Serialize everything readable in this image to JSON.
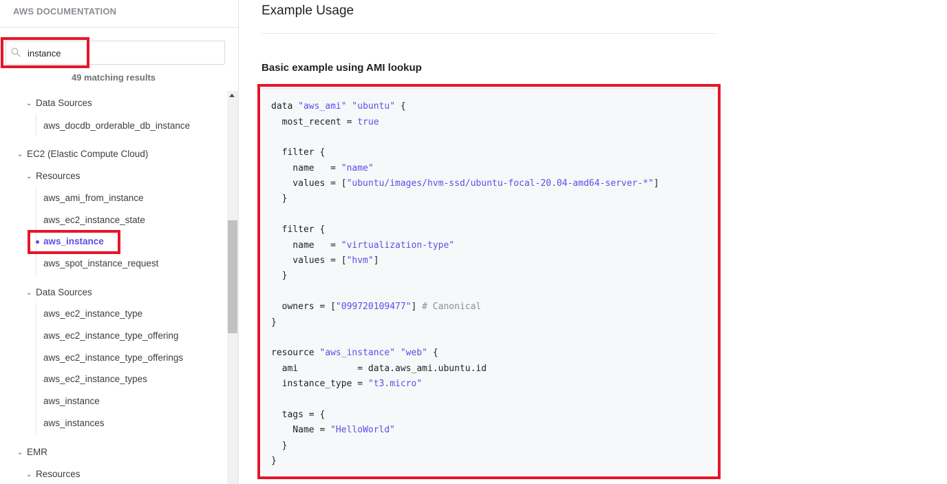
{
  "sidebar": {
    "title": "AWS DOCUMENTATION",
    "search": {
      "value": "instance",
      "placeholder": ""
    },
    "match_count": "49 matching results",
    "items": {
      "docdb_data_sources": "Data Sources",
      "docdb_orderable": "aws_docdb_orderable_db_instance",
      "ec2_group": "EC2 (Elastic Compute Cloud)",
      "ec2_resources": "Resources",
      "ami_from_instance": "aws_ami_from_instance",
      "ec2_instance_state": "aws_ec2_instance_state",
      "aws_instance": "aws_instance",
      "spot_instance_request": "aws_spot_instance_request",
      "ec2_data_sources": "Data Sources",
      "ec2_instance_type": "aws_ec2_instance_type",
      "ec2_instance_type_offering": "aws_ec2_instance_type_offering",
      "ec2_instance_type_offerings": "aws_ec2_instance_type_offerings",
      "ec2_instance_types": "aws_ec2_instance_types",
      "ds_aws_instance": "aws_instance",
      "ds_aws_instances": "aws_instances",
      "emr_group": "EMR",
      "emr_resources": "Resources"
    }
  },
  "main": {
    "heading": "Example Usage",
    "subheading": "Basic example using AMI lookup"
  },
  "code": {
    "l1a": "data ",
    "l1b": "\"aws_ami\"",
    "l1c": " ",
    "l1d": "\"ubuntu\"",
    "l1e": " {",
    "l2a": "  most_recent = ",
    "l2b": "true",
    "l4": "  filter {",
    "l5a": "    name   = ",
    "l5b": "\"name\"",
    "l6a": "    values = [",
    "l6b": "\"ubuntu/images/hvm-ssd/ubuntu-focal-20.04-amd64-server-*\"",
    "l6c": "]",
    "l7": "  }",
    "l9": "  filter {",
    "l10a": "    name   = ",
    "l10b": "\"virtualization-type\"",
    "l11a": "    values = [",
    "l11b": "\"hvm\"",
    "l11c": "]",
    "l12": "  }",
    "l14a": "  owners = [",
    "l14b": "\"099720109477\"",
    "l14c": "] ",
    "l14d": "# Canonical",
    "l15": "}",
    "l17a": "resource ",
    "l17b": "\"aws_instance\"",
    "l17c": " ",
    "l17d": "\"web\"",
    "l17e": " {",
    "l18": "  ami           = data.aws_ami.ubuntu.id",
    "l19a": "  instance_type = ",
    "l19b": "\"t3.micro\"",
    "l21": "  tags = {",
    "l22a": "    Name = ",
    "l22b": "\"HelloWorld\"",
    "l23": "  }",
    "l24": "}"
  },
  "colors": {
    "accent": "#5c4ee5",
    "annotation_red": "#e5162a",
    "code_bg": "#f7f8fa"
  }
}
